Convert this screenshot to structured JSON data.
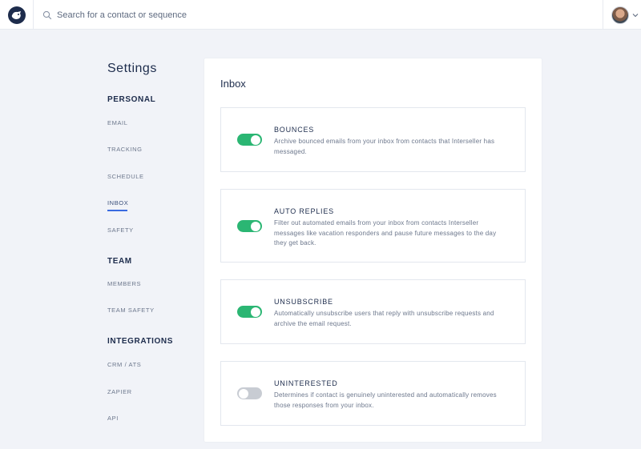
{
  "search": {
    "placeholder": "Search for a contact or sequence"
  },
  "sidebar": {
    "title": "Settings",
    "sections": [
      {
        "heading": "PERSONAL",
        "items": [
          "EMAIL",
          "TRACKING",
          "SCHEDULE",
          "INBOX",
          "SAFETY"
        ]
      },
      {
        "heading": "TEAM",
        "items": [
          "MEMBERS",
          "TEAM SAFETY"
        ]
      },
      {
        "heading": "INTEGRATIONS",
        "items": [
          "CRM / ATS",
          "ZAPIER",
          "API"
        ]
      }
    ],
    "active_item": "INBOX"
  },
  "main": {
    "title": "Inbox",
    "options": [
      {
        "title": "BOUNCES",
        "enabled": true,
        "description": "Archive bounced emails from your inbox from contacts that Interseller has messaged."
      },
      {
        "title": "AUTO REPLIES",
        "enabled": true,
        "description": "Filter out automated emails from your inbox from contacts Interseller messages like vacation responders and pause future messages to the day they get back."
      },
      {
        "title": "UNSUBSCRIBE",
        "enabled": true,
        "description": "Automatically unsubscribe users that reply with unsubscribe requests and archive the email request."
      },
      {
        "title": "UNINTERESTED",
        "enabled": false,
        "description": "Determines if contact is genuinely uninterested and automatically removes those responses from your inbox."
      }
    ]
  },
  "colors": {
    "accent": "#3a6be0",
    "toggle_on": "#2bb673",
    "toggle_off": "#c8ccd3",
    "navy": "#1d2c4c"
  },
  "icons": {
    "logo": "interseller-logo-icon",
    "search": "search-icon",
    "avatar": "user-avatar",
    "menu": "chevron-down-icon"
  }
}
